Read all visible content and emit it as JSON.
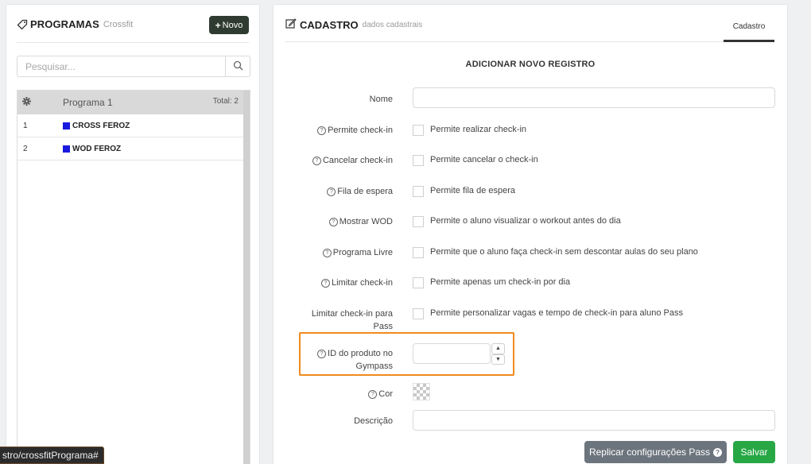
{
  "left": {
    "title": "PROGRAMAS",
    "subtitle": "Crossfit",
    "novo_label": "Novo",
    "search_placeholder": "Pesquisar...",
    "list_header": {
      "name": "Programa 1",
      "total": "Total: 2"
    },
    "items": [
      {
        "num": "1",
        "name": "CROSS FEROZ",
        "color": "#1a1adf"
      },
      {
        "num": "2",
        "name": "WOD FEROZ",
        "color": "#1a1adf"
      }
    ]
  },
  "right": {
    "title": "CADASTRO",
    "subtitle": "dados cadastrais",
    "tab": "Cadastro",
    "section_title": "ADICIONAR NOVO REGISTRO",
    "fields": {
      "nome": "Nome",
      "permite_checkin": {
        "label": "Permite check-in",
        "text": "Permite realizar check-in"
      },
      "cancelar_checkin": {
        "label": "Cancelar check-in",
        "text": "Permite cancelar o check-in"
      },
      "fila_espera": {
        "label": "Fila de espera",
        "text": "Permite fila de espera"
      },
      "mostrar_wod": {
        "label": "Mostrar WOD",
        "text": "Permite o aluno visualizar o workout antes do dia"
      },
      "programa_livre": {
        "label": "Programa Livre",
        "text": "Permite que o aluno faça check-in sem descontar aulas do seu plano"
      },
      "limitar_checkin": {
        "label": "Limitar check-in",
        "text": "Permite apenas um check-in por dia"
      },
      "limitar_pass": {
        "label_line1": "Limitar check-in para",
        "label_line2": "Pass",
        "text": "Permite personalizar vagas e tempo de check-in para aluno Pass"
      },
      "id_gympass": {
        "label_line1": "ID do produto no",
        "label_line2": "Gympass",
        "value": ""
      },
      "cor": "Cor",
      "descricao": "Descrição"
    },
    "buttons": {
      "replicar": "Replicar configurações Pass",
      "salvar": "Salvar"
    }
  },
  "status_url": "stro/crossfitPrograma#",
  "colors": {
    "highlight": "#f08a1c",
    "salvar": "#28a745",
    "replicar": "#6c757d",
    "novo": "#2f3b30"
  }
}
